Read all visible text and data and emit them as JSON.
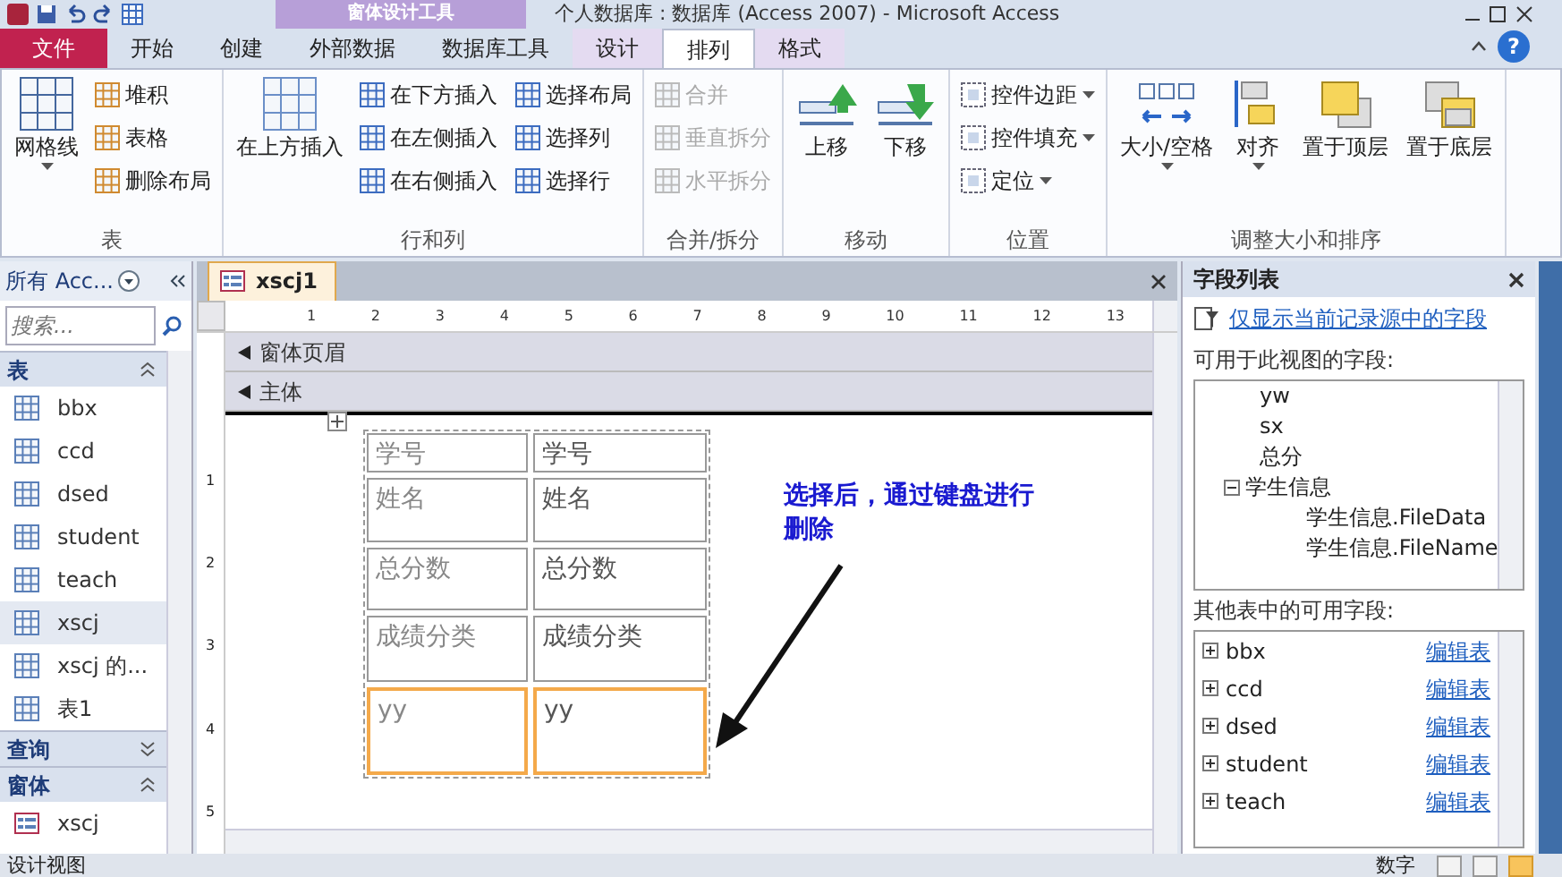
{
  "title_bar": {
    "context_group": "窗体设计工具",
    "title": "个人数据库 : 数据库 (Access 2007) - Microsoft Access"
  },
  "ribbon_tabs": [
    {
      "label": "文件",
      "kind": "file",
      "selected": false
    },
    {
      "label": "开始",
      "kind": "normal",
      "selected": false
    },
    {
      "label": "创建",
      "kind": "normal",
      "selected": false
    },
    {
      "label": "外部数据",
      "kind": "normal",
      "selected": false
    },
    {
      "label": "数据库工具",
      "kind": "normal",
      "selected": false
    },
    {
      "label": "设计",
      "kind": "context",
      "selected": false
    },
    {
      "label": "排列",
      "kind": "context",
      "selected": true
    },
    {
      "label": "格式",
      "kind": "context",
      "selected": false
    }
  ],
  "help": "?",
  "ribbon_groups": [
    {
      "label": "表",
      "buttons": [
        {
          "label": "网格线",
          "kind": "large",
          "dropdown": true,
          "disabled": false
        },
        {
          "label": "堆积",
          "kind": "small",
          "dropdown": false,
          "disabled": false
        },
        {
          "label": "表格",
          "kind": "small",
          "dropdown": false,
          "disabled": false
        },
        {
          "label": "删除布局",
          "kind": "small",
          "dropdown": false,
          "disabled": false
        }
      ]
    },
    {
      "label": "行和列",
      "buttons": [
        {
          "label": "在上方插入",
          "kind": "large",
          "dropdown": false,
          "disabled": false
        },
        {
          "label": "在下方插入",
          "kind": "small",
          "dropdown": false,
          "disabled": false
        },
        {
          "label": "在左侧插入",
          "kind": "small",
          "dropdown": false,
          "disabled": false
        },
        {
          "label": "在右侧插入",
          "kind": "small",
          "dropdown": false,
          "disabled": false
        },
        {
          "label": "选择布局",
          "kind": "small",
          "dropdown": false,
          "disabled": false
        },
        {
          "label": "选择列",
          "kind": "small",
          "dropdown": false,
          "disabled": false
        },
        {
          "label": "选择行",
          "kind": "small",
          "dropdown": false,
          "disabled": false
        }
      ]
    },
    {
      "label": "合并/拆分",
      "buttons": [
        {
          "label": "合并",
          "kind": "small",
          "dropdown": false,
          "disabled": true
        },
        {
          "label": "垂直拆分",
          "kind": "small",
          "dropdown": false,
          "disabled": true
        },
        {
          "label": "水平拆分",
          "kind": "small",
          "dropdown": false,
          "disabled": true
        }
      ]
    },
    {
      "label": "移动",
      "buttons": [
        {
          "label": "上移",
          "kind": "large",
          "dropdown": false,
          "disabled": false
        },
        {
          "label": "下移",
          "kind": "large",
          "dropdown": false,
          "disabled": false
        }
      ]
    },
    {
      "label": "位置",
      "buttons": [
        {
          "label": "控件边距",
          "kind": "small",
          "dropdown": true,
          "disabled": false
        },
        {
          "label": "控件填充",
          "kind": "small",
          "dropdown": true,
          "disabled": false
        },
        {
          "label": "定位",
          "kind": "small",
          "dropdown": true,
          "disabled": false
        }
      ]
    },
    {
      "label": "调整大小和排序",
      "buttons": [
        {
          "label": "大小/空格",
          "kind": "large",
          "dropdown": true,
          "disabled": false
        },
        {
          "label": "对齐",
          "kind": "large",
          "dropdown": true,
          "disabled": false
        },
        {
          "label": "置于顶层",
          "kind": "large",
          "dropdown": false,
          "disabled": false
        },
        {
          "label": "置于底层",
          "kind": "large",
          "dropdown": false,
          "disabled": false
        }
      ]
    }
  ],
  "nav_pane": {
    "title": "所有 Acc...",
    "search": {
      "placeholder": "搜索..."
    },
    "groups": [
      {
        "label": "表",
        "kind": "table",
        "expanded": true,
        "items": [
          {
            "label": "bbx",
            "selected": false
          },
          {
            "label": "ccd",
            "selected": false
          },
          {
            "label": "dsed",
            "selected": false
          },
          {
            "label": "student",
            "selected": false
          },
          {
            "label": "teach",
            "selected": false
          },
          {
            "label": "xscj",
            "selected": true
          },
          {
            "label": "xscj 的...",
            "selected": false
          },
          {
            "label": "表1",
            "selected": false
          }
        ]
      },
      {
        "label": "查询",
        "expanded": false
      },
      {
        "label": "窗体",
        "kind": "form",
        "expanded": true,
        "items": [
          {
            "label": "xscj",
            "selected": false
          }
        ]
      }
    ]
  },
  "document": {
    "tab": "xscj1",
    "ruler": [
      "1",
      "2",
      "3",
      "4",
      "5",
      "6",
      "7",
      "8",
      "9",
      "10",
      "11",
      "12",
      "13"
    ],
    "vertical_ruler": [
      "1",
      "2",
      "3",
      "4",
      "5"
    ],
    "sections": [
      "窗体页眉",
      "主体"
    ],
    "controls": [
      {
        "label": "学号",
        "field": "学号",
        "selected": false
      },
      {
        "label": "姓名",
        "field": "姓名",
        "selected": false
      },
      {
        "label": "总分数",
        "field": "总分数",
        "selected": false
      },
      {
        "label": "成绩分类",
        "field": "成绩分类",
        "selected": false
      },
      {
        "label": "yy",
        "field": "yy",
        "selected": true
      }
    ],
    "annotation": "选择后，通过键盘进行删除"
  },
  "field_list": {
    "title": "字段列表",
    "show_only_link": "仅显示当前记录源中的字段",
    "available_label": "可用于此视图的字段:",
    "fields": [
      {
        "label": "yw"
      },
      {
        "label": "sx"
      },
      {
        "label": "总分"
      },
      {
        "label": "学生信息",
        "expanded": true,
        "children": [
          {
            "label": "学生信息.FileData"
          },
          {
            "label": "学生信息.FileName"
          }
        ]
      }
    ],
    "other_label": "其他表中的可用字段:",
    "other_tables": [
      {
        "label": "bbx",
        "expanded": false,
        "link": "编辑表"
      },
      {
        "label": "ccd",
        "expanded": false,
        "link": "编辑表"
      },
      {
        "label": "dsed",
        "expanded": false,
        "link": "编辑表"
      },
      {
        "label": "student",
        "expanded": false,
        "link": "编辑表"
      },
      {
        "label": "teach",
        "expanded": false,
        "link": "编辑表"
      }
    ]
  },
  "status_bar": {
    "left": "设计视图",
    "right": "数字",
    "views": [
      {
        "selected": false
      },
      {
        "selected": false
      },
      {
        "selected": true
      }
    ]
  }
}
